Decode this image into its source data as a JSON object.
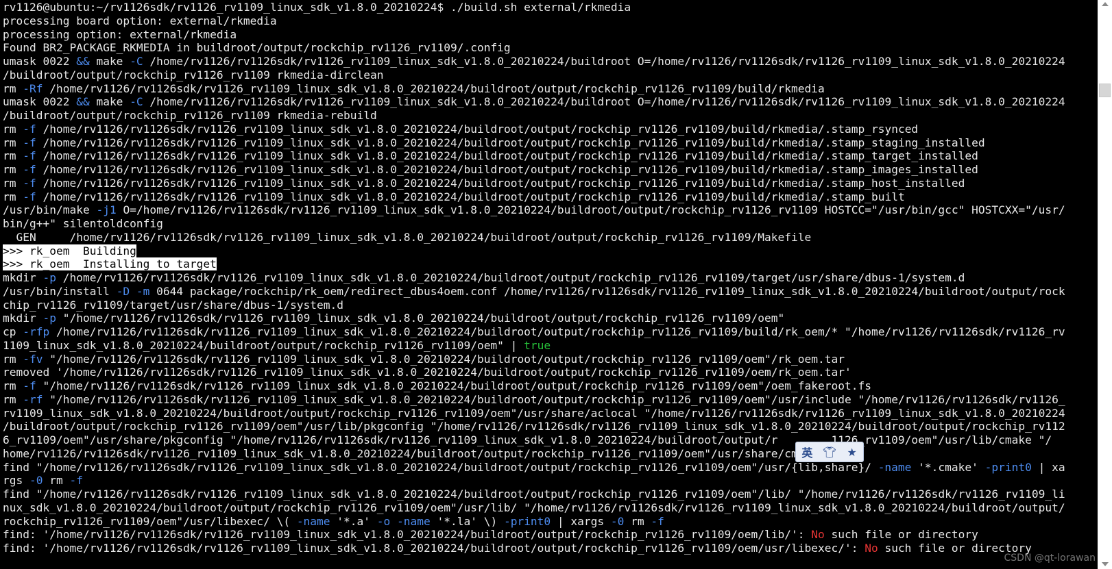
{
  "terminal": {
    "lines": [
      [
        [
          "n",
          "rv1126@ubuntu:~/rv1126sdk/rv1126_rv1109_linux_sdk_v1.8.0_20210224$ ./build.sh external/rkmedia"
        ]
      ],
      [
        [
          "n",
          "processing board option: external/rkmedia"
        ]
      ],
      [
        [
          "n",
          "processing option: external/rkmedia"
        ]
      ],
      [
        [
          "n",
          "Found BR2_PACKAGE_RKMEDIA in buildroot/output/rockchip_rv1126_rv1109/.config"
        ]
      ],
      [
        [
          "n",
          "umask 0022 "
        ],
        [
          "b",
          "&&"
        ],
        [
          "n",
          " make "
        ],
        [
          "b",
          "-C"
        ],
        [
          "n",
          " /home/rv1126/rv1126sdk/rv1126_rv1109_linux_sdk_v1.8.0_20210224/buildroot O=/home/rv1126/rv1126sdk/rv1126_rv1109_linux_sdk_v1.8.0_20210224"
        ]
      ],
      [
        [
          "n",
          "/buildroot/output/rockchip_rv1126_rv1109 rkmedia-dirclean"
        ]
      ],
      [
        [
          "n",
          "rm "
        ],
        [
          "b",
          "-Rf"
        ],
        [
          "n",
          " /home/rv1126/rv1126sdk/rv1126_rv1109_linux_sdk_v1.8.0_20210224/buildroot/output/rockchip_rv1126_rv1109/build/rkmedia"
        ]
      ],
      [
        [
          "n",
          "umask 0022 "
        ],
        [
          "b",
          "&&"
        ],
        [
          "n",
          " make "
        ],
        [
          "b",
          "-C"
        ],
        [
          "n",
          " /home/rv1126/rv1126sdk/rv1126_rv1109_linux_sdk_v1.8.0_20210224/buildroot O=/home/rv1126/rv1126sdk/rv1126_rv1109_linux_sdk_v1.8.0_20210224"
        ]
      ],
      [
        [
          "n",
          "/buildroot/output/rockchip_rv1126_rv1109 rkmedia-rebuild"
        ]
      ],
      [
        [
          "n",
          "rm "
        ],
        [
          "b",
          "-f"
        ],
        [
          "n",
          " /home/rv1126/rv1126sdk/rv1126_rv1109_linux_sdk_v1.8.0_20210224/buildroot/output/rockchip_rv1126_rv1109/build/rkmedia/.stamp_rsynced"
        ]
      ],
      [
        [
          "n",
          "rm "
        ],
        [
          "b",
          "-f"
        ],
        [
          "n",
          " /home/rv1126/rv1126sdk/rv1126_rv1109_linux_sdk_v1.8.0_20210224/buildroot/output/rockchip_rv1126_rv1109/build/rkmedia/.stamp_staging_installed"
        ]
      ],
      [
        [
          "n",
          "rm "
        ],
        [
          "b",
          "-f"
        ],
        [
          "n",
          " /home/rv1126/rv1126sdk/rv1126_rv1109_linux_sdk_v1.8.0_20210224/buildroot/output/rockchip_rv1126_rv1109/build/rkmedia/.stamp_target_installed"
        ]
      ],
      [
        [
          "n",
          "rm "
        ],
        [
          "b",
          "-f"
        ],
        [
          "n",
          " /home/rv1126/rv1126sdk/rv1126_rv1109_linux_sdk_v1.8.0_20210224/buildroot/output/rockchip_rv1126_rv1109/build/rkmedia/.stamp_images_installed"
        ]
      ],
      [
        [
          "n",
          "rm "
        ],
        [
          "b",
          "-f"
        ],
        [
          "n",
          " /home/rv1126/rv1126sdk/rv1126_rv1109_linux_sdk_v1.8.0_20210224/buildroot/output/rockchip_rv1126_rv1109/build/rkmedia/.stamp_host_installed"
        ]
      ],
      [
        [
          "n",
          "rm "
        ],
        [
          "b",
          "-f"
        ],
        [
          "n",
          " /home/rv1126/rv1126sdk/rv1126_rv1109_linux_sdk_v1.8.0_20210224/buildroot/output/rockchip_rv1126_rv1109/build/rkmedia/.stamp_built"
        ]
      ],
      [
        [
          "n",
          "/usr/bin/make "
        ],
        [
          "b",
          "-j1"
        ],
        [
          "n",
          " O=/home/rv1126/rv1126sdk/rv1126_rv1109_linux_sdk_v1.8.0_20210224/buildroot/output/rockchip_rv1126_rv1109 HOSTCC=\"/usr/bin/gcc\" HOSTCXX=\"/usr/"
        ]
      ],
      [
        [
          "n",
          "bin/g++\" silentoldconfig"
        ]
      ],
      [
        [
          "n",
          "  GEN     /home/rv1126/rv1126sdk/rv1126_rv1109_linux_sdk_v1.8.0_20210224/buildroot/output/rockchip_rv1126_rv1109/Makefile"
        ]
      ],
      [
        [
          "hl",
          ">>> rk_oem  Building"
        ]
      ],
      [
        [
          "hl",
          ">>> rk_oem  Installing to target"
        ]
      ],
      [
        [
          "n",
          "mkdir "
        ],
        [
          "b",
          "-p"
        ],
        [
          "n",
          " /home/rv1126/rv1126sdk/rv1126_rv1109_linux_sdk_v1.8.0_20210224/buildroot/output/rockchip_rv1126_rv1109/target/usr/share/dbus-1/system.d"
        ]
      ],
      [
        [
          "n",
          "/usr/bin/install "
        ],
        [
          "b",
          "-D -m"
        ],
        [
          "n",
          " 0644 package/rockchip/rk_oem/redirect_dbus4oem.conf /home/rv1126/rv1126sdk/rv1126_rv1109_linux_sdk_v1.8.0_20210224/buildroot/output/rock"
        ]
      ],
      [
        [
          "n",
          "chip_rv1126_rv1109/target/usr/share/dbus-1/system.d"
        ]
      ],
      [
        [
          "n",
          "mkdir "
        ],
        [
          "b",
          "-p"
        ],
        [
          "n",
          " \"/home/rv1126/rv1126sdk/rv1126_rv1109_linux_sdk_v1.8.0_20210224/buildroot/output/rockchip_rv1126_rv1109/oem\""
        ]
      ],
      [
        [
          "n",
          "cp "
        ],
        [
          "b",
          "-rfp"
        ],
        [
          "n",
          " /home/rv1126/rv1126sdk/rv1126_rv1109_linux_sdk_v1.8.0_20210224/buildroot/output/rockchip_rv1126_rv1109/build/rk_oem/* \"/home/rv1126/rv1126sdk/rv1126_rv"
        ]
      ],
      [
        [
          "n",
          "1109_linux_sdk_v1.8.0_20210224/buildroot/output/rockchip_rv1126_rv1109/oem\" | "
        ],
        [
          "g",
          "true"
        ]
      ],
      [
        [
          "n",
          "rm "
        ],
        [
          "b",
          "-fv"
        ],
        [
          "n",
          " \"/home/rv1126/rv1126sdk/rv1126_rv1109_linux_sdk_v1.8.0_20210224/buildroot/output/rockchip_rv1126_rv1109/oem\"/rk_oem.tar"
        ]
      ],
      [
        [
          "n",
          "removed '/home/rv1126/rv1126sdk/rv1126_rv1109_linux_sdk_v1.8.0_20210224/buildroot/output/rockchip_rv1126_rv1109/oem/rk_oem.tar'"
        ]
      ],
      [
        [
          "n",
          "rm "
        ],
        [
          "b",
          "-f"
        ],
        [
          "n",
          " \"/home/rv1126/rv1126sdk/rv1126_rv1109_linux_sdk_v1.8.0_20210224/buildroot/output/rockchip_rv1126_rv1109/oem\"/oem_fakeroot.fs"
        ]
      ],
      [
        [
          "n",
          "rm "
        ],
        [
          "b",
          "-rf"
        ],
        [
          "n",
          " \"/home/rv1126/rv1126sdk/rv1126_rv1109_linux_sdk_v1.8.0_20210224/buildroot/output/rockchip_rv1126_rv1109/oem\"/usr/include \"/home/rv1126/rv1126sdk/rv1126_"
        ]
      ],
      [
        [
          "n",
          "rv1109_linux_sdk_v1.8.0_20210224/buildroot/output/rockchip_rv1126_rv1109/oem\"/usr/share/aclocal \"/home/rv1126/rv1126sdk/rv1126_rv1109_linux_sdk_v1.8.0_20210224"
        ]
      ],
      [
        [
          "n",
          "/buildroot/output/rockchip_rv1126_rv1109/oem\"/usr/lib/pkgconfig \"/home/rv1126/rv1126sdk/rv1126_rv1109_linux_sdk_v1.8.0_20210224/buildroot/output/rockchip_rv112"
        ]
      ],
      [
        [
          "n",
          "6_rv1109/oem\"/usr/share/pkgconfig \"/home/rv1126/rv1126sdk/rv1126_rv1109_linux_sdk_v1.8.0_20210224/buildroot/output/r        1126_rv1109/oem\"/usr/lib/cmake \"/"
        ]
      ],
      [
        [
          "n",
          "home/rv1126/rv1126sdk/rv1126_rv1109_linux_sdk_v1.8.0_20210224/buildroot/output/rockchip_rv1126_rv1109/oem\"/usr/share/cmake"
        ]
      ],
      [
        [
          "n",
          "find \"/home/rv1126/rv1126sdk/rv1126_rv1109_linux_sdk_v1.8.0_20210224/buildroot/output/rockchip_rv1126_rv1109/oem\"/usr/{lib,share}/ "
        ],
        [
          "b",
          "-name"
        ],
        [
          "n",
          " '*.cmake' "
        ],
        [
          "b",
          "-print0"
        ],
        [
          "n",
          " | xa"
        ]
      ],
      [
        [
          "n",
          "rgs "
        ],
        [
          "b",
          "-0"
        ],
        [
          "n",
          " rm "
        ],
        [
          "b",
          "-f"
        ]
      ],
      [
        [
          "n",
          "find \"/home/rv1126/rv1126sdk/rv1126_rv1109_linux_sdk_v1.8.0_20210224/buildroot/output/rockchip_rv1126_rv1109/oem\"/lib/ \"/home/rv1126/rv1126sdk/rv1126_rv1109_li"
        ]
      ],
      [
        [
          "n",
          "nux_sdk_v1.8.0_20210224/buildroot/output/rockchip_rv1126_rv1109/oem\"/usr/lib/ \"/home/rv1126/rv1126sdk/rv1126_rv1109_linux_sdk_v1.8.0_20210224/buildroot/output/"
        ]
      ],
      [
        [
          "n",
          "rockchip_rv1126_rv1109/oem\"/usr/libexec/ \\( "
        ],
        [
          "b",
          "-name"
        ],
        [
          "n",
          " '*.a' "
        ],
        [
          "b",
          "-o -name"
        ],
        [
          "n",
          " '*.la' \\) "
        ],
        [
          "b",
          "-print0"
        ],
        [
          "n",
          " | xargs "
        ],
        [
          "b",
          "-0"
        ],
        [
          "n",
          " rm "
        ],
        [
          "b",
          "-f"
        ]
      ],
      [
        [
          "n",
          "find: '/home/rv1126/rv1126sdk/rv1126_rv1109_linux_sdk_v1.8.0_20210224/buildroot/output/rockchip_rv1126_rv1109/oem/lib/': "
        ],
        [
          "r",
          "No"
        ],
        [
          "n",
          " such file or directory"
        ]
      ],
      [
        [
          "n",
          "find: '/home/rv1126/rv1126sdk/rv1126_rv1109_linux_sdk_v1.8.0_20210224/buildroot/output/rockchip_rv1126_rv1109/oem/usr/libexec/': "
        ],
        [
          "r",
          "No"
        ],
        [
          "n",
          " such file or directory"
        ]
      ]
    ]
  },
  "ime_toolbar": {
    "lang": "英",
    "skin_icon": "shirt-icon",
    "star_icon": "star-icon"
  },
  "watermark": "CSDN @qt-lorawan",
  "colors": {
    "background": "#000000",
    "text": "#e8e8e8",
    "option": "#4d8cf0",
    "keyword_true": "#27c23a",
    "error_no": "#e83535",
    "highlight_bg": "#ffffff"
  }
}
